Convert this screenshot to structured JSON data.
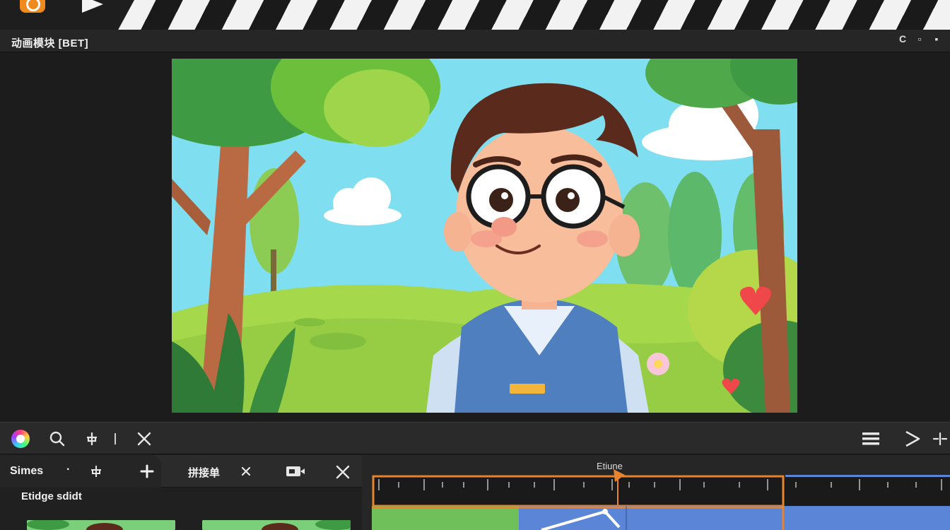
{
  "window": {
    "title": "动画模块 [BET]",
    "controls": [
      "C",
      "▫",
      "▪"
    ]
  },
  "toolbar": {
    "left_tools": [
      "color-picker",
      "search",
      "pin",
      "divider",
      "close"
    ],
    "right_tools": [
      "menu",
      "play",
      "split"
    ]
  },
  "scenes_panel": {
    "title": "Simes",
    "dot": "·",
    "action_label": "拼接单",
    "subheader": "Etidge sdidt"
  },
  "timeline": {
    "label": "Etiune"
  },
  "colors": {
    "accent": "#f08a1c",
    "playhead": "#e8842e",
    "track_green": "#6fbf5a",
    "track_blue": "#5b86d8",
    "sky": "#7fdff0"
  },
  "icons": {
    "logo": "logo-icon",
    "play": "play-icon",
    "search": "search-icon",
    "pin": "pin-icon",
    "close": "close-icon",
    "menu": "menu-icon",
    "add": "add-icon",
    "camera": "camera-icon"
  }
}
